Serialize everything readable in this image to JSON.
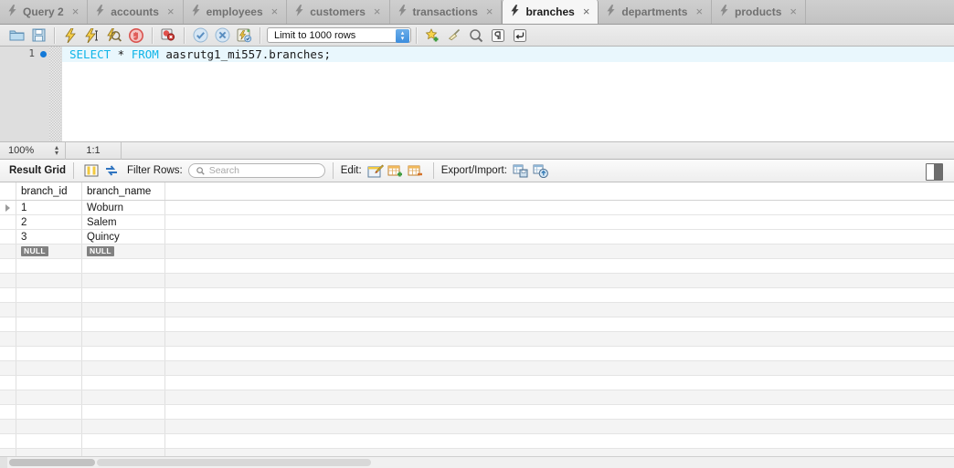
{
  "tabs": [
    {
      "label": "Query 2",
      "icon": "lightning-icon",
      "active": false
    },
    {
      "label": "accounts",
      "icon": "lightning-icon",
      "active": false
    },
    {
      "label": "employees",
      "icon": "lightning-icon",
      "active": false
    },
    {
      "label": "customers",
      "icon": "lightning-icon",
      "active": false
    },
    {
      "label": "transactions",
      "icon": "lightning-icon",
      "active": false
    },
    {
      "label": "branches",
      "icon": "lightning-icon",
      "active": true
    },
    {
      "label": "departments",
      "icon": "lightning-icon",
      "active": false
    },
    {
      "label": "products",
      "icon": "lightning-icon",
      "active": false
    }
  ],
  "tab_close_glyph": "×",
  "toolbar": {
    "open_sql_icon": "folder-open-icon",
    "save_sql_icon": "floppy-save-icon",
    "execute_icon": "lightning-execute-icon",
    "execute_current_icon": "lightning-cursor-icon",
    "explain_icon": "lightning-magnifier-icon",
    "stop_icon": "stop-hand-icon",
    "toggle_stop_on_error_icon": "stop-on-error-icon",
    "commit_icon": "commit-check-icon",
    "rollback_icon": "rollback-x-icon",
    "autocommit_icon": "autocommit-icon",
    "limit_value": "Limit to 1000 rows",
    "limit_stepper_up": "▴",
    "limit_stepper_down": "▾",
    "snippets_icon": "star-plus-icon",
    "beautify_icon": "broom-icon",
    "find_icon": "magnifier-icon",
    "invisible_chars_icon": "pilcrow-icon",
    "wrap_lines_icon": "wrap-lines-icon"
  },
  "editor": {
    "line_number": "1",
    "bookmark_icon": "blue-dot-marker",
    "code_keyword_1": "SELECT",
    "code_star": " * ",
    "code_keyword_2": "FROM",
    "code_rest": " aasrutg1_mi557.branches;"
  },
  "editor_status": {
    "zoom": "100%",
    "stepper_up": "▴",
    "stepper_down": "▾",
    "cursor_position": "1:1"
  },
  "result_toolbar": {
    "title": "Result Grid",
    "grid_view_icon": "grid-columns-icon",
    "form_view_icon": "swap-arrows-icon",
    "filter_label": "Filter Rows:",
    "search_icon": "search-icon",
    "search_placeholder": "Search",
    "search_value": "",
    "edit_label": "Edit:",
    "edit_row_icon": "pencil-edit-icon",
    "insert_row_icon": "grid-plus-icon",
    "delete_row_icon": "grid-minus-icon",
    "export_import_label": "Export/Import:",
    "export_icon": "export-floppy-icon",
    "import_icon": "import-arrow-icon",
    "panel_toggle_icon": "sidebar-toggle-icon"
  },
  "result_grid": {
    "columns": [
      "branch_id",
      "branch_name"
    ],
    "rows": [
      {
        "selected": true,
        "branch_id": "1",
        "branch_name": "Woburn"
      },
      {
        "selected": false,
        "branch_id": "2",
        "branch_name": "Salem"
      },
      {
        "selected": false,
        "branch_id": "3",
        "branch_name": "Quincy"
      }
    ],
    "null_label": "NULL",
    "empty_row_count": 14
  },
  "colors": {
    "tab_active_bg": "#f6f6f6",
    "tabbar_bg": "#c8c8c8",
    "keyword": "#10b5e8",
    "active_line": "#e9f7fd",
    "row_alt": "#f4f4f4",
    "null_badge": "#818181",
    "marker_blue": "#1379d8"
  }
}
